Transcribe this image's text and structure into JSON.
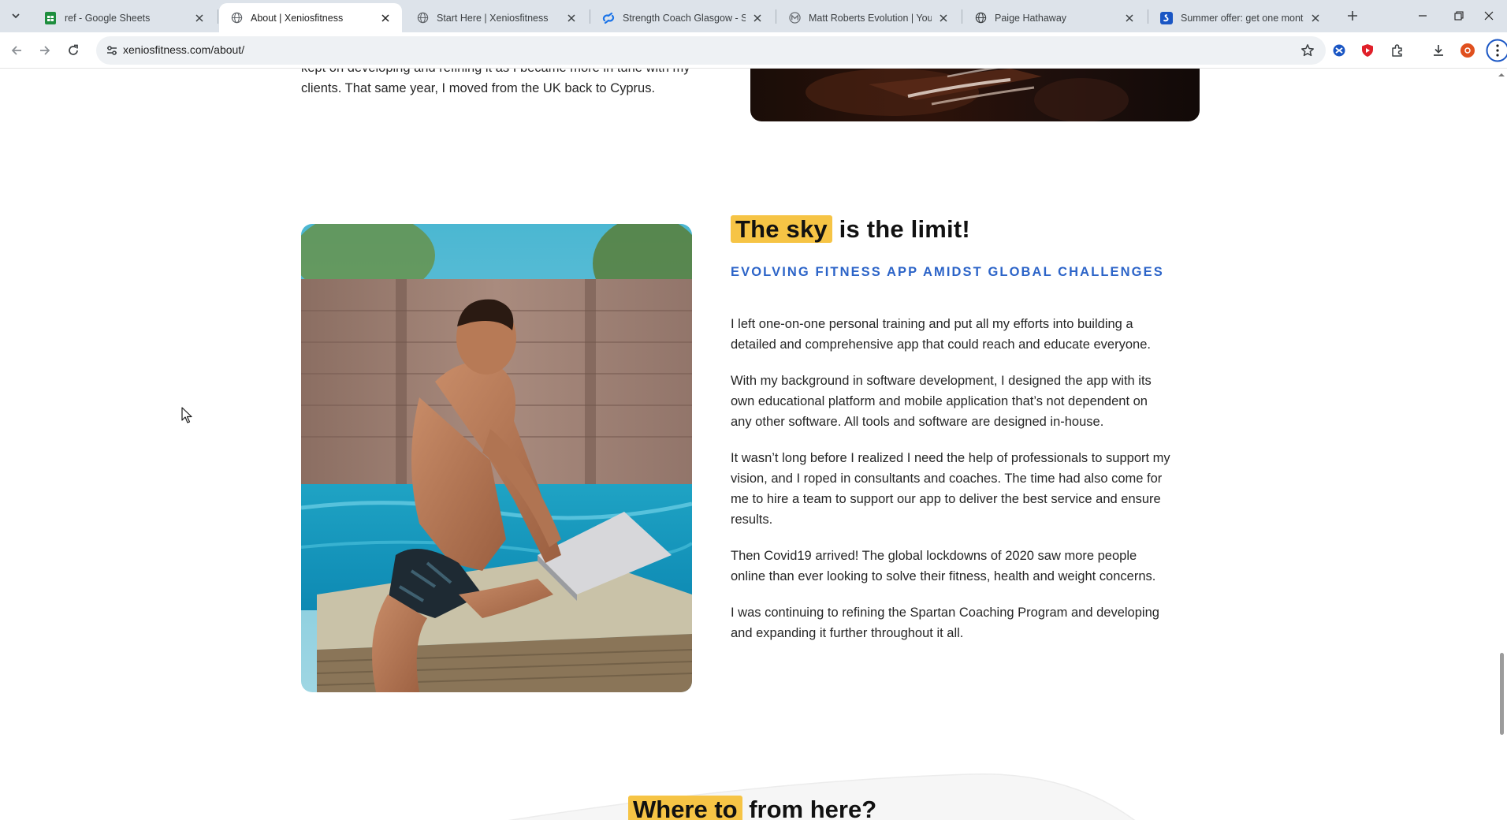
{
  "browser": {
    "tabs": [
      {
        "title": "ref - Google Sheets",
        "icon": "google-sheets-icon"
      },
      {
        "title": "About | Xeniosfitness",
        "icon": "globe-icon",
        "active": true
      },
      {
        "title": "Start Here | Xeniosfitness",
        "icon": "globe-icon"
      },
      {
        "title": "Strength Coach Glasgow - Simp",
        "icon": "squarespace-icon"
      },
      {
        "title": "Matt Roberts Evolution | Young",
        "icon": "m-logo-icon"
      },
      {
        "title": "Paige Hathaway",
        "icon": "globe-icon"
      },
      {
        "title": "Summer offer: get one month f",
        "icon": "shopify-icon"
      }
    ],
    "url": "xeniosfitness.com/about/"
  },
  "page": {
    "top_paragraph": "kept on developing and refining it as I became more in tune with my clients. That same year, I moved from the UK back to Cyprus.",
    "section": {
      "heading_highlight": "The sky",
      "heading_rest": " is the limit!",
      "subheading": "EVOLVING FITNESS APP AMIDST GLOBAL CHALLENGES",
      "paragraphs": [
        "I left one-on-one personal training and put all my efforts into building a detailed and comprehensive app that could reach and educate everyone.",
        "With my background in software development, I designed the app with its own educational platform and mobile application that’s not dependent on any other software. All tools and software are designed in-house.",
        "It wasn’t long before I realized I need the help of professionals to support my vision, and I roped in consultants and coaches. The time had also come for me to hire a team to support our app to deliver the best service and ensure results.",
        "Then Covid19 arrived! The global lockdowns of 2020 saw more people online than ever looking to solve their fitness, health and weight concerns.",
        "I was continuing to refining the Spartan Coaching Program and developing and expanding it further throughout it all."
      ]
    },
    "next_heading_highlight": "Where to",
    "next_heading_rest": " from here?"
  },
  "colors": {
    "highlight": "#f6c445",
    "accent_blue": "#2c64c8",
    "tabstrip": "#dde3ea"
  }
}
